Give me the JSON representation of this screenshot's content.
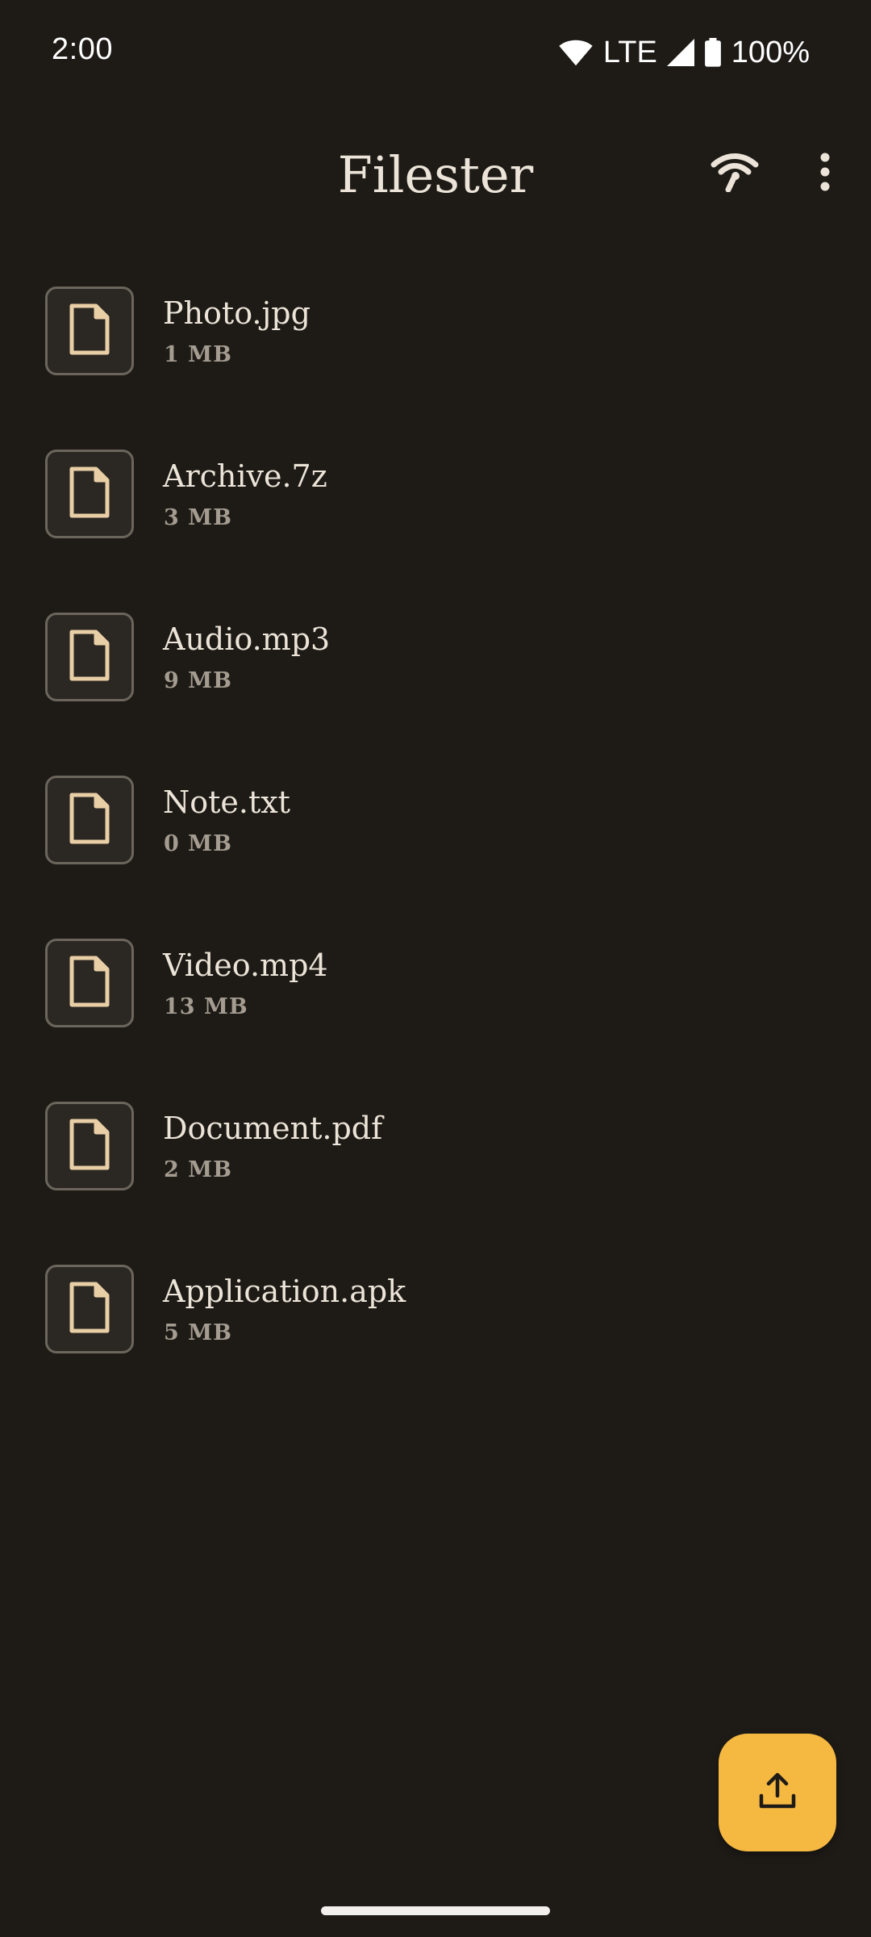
{
  "status_bar": {
    "time": "2:00",
    "network": "LTE",
    "battery": "100%",
    "icons": [
      "wifi-icon",
      "signal-icon",
      "battery-icon"
    ]
  },
  "app_bar": {
    "title": "Filester",
    "actions": [
      "wifi-tethering-icon",
      "more-vert-icon"
    ]
  },
  "files": [
    {
      "name": "Photo.jpg",
      "size": "1 MB",
      "icon": "file-icon"
    },
    {
      "name": "Archive.7z",
      "size": "3 MB",
      "icon": "file-icon"
    },
    {
      "name": "Audio.mp3",
      "size": "9 MB",
      "icon": "file-icon"
    },
    {
      "name": "Note.txt",
      "size": "0 MB",
      "icon": "file-icon"
    },
    {
      "name": "Video.mp4",
      "size": "13 MB",
      "icon": "file-icon"
    },
    {
      "name": "Document.pdf",
      "size": "2 MB",
      "icon": "file-icon"
    },
    {
      "name": "Application.apk",
      "size": "5 MB",
      "icon": "file-icon"
    }
  ],
  "fab": {
    "icon": "upload-icon"
  },
  "colors": {
    "background": "#1e1b17",
    "accent": "#f5b942",
    "text": "#ece4d8",
    "secondary_text": "#a49c90",
    "file_icon": "#e8cfa6"
  }
}
